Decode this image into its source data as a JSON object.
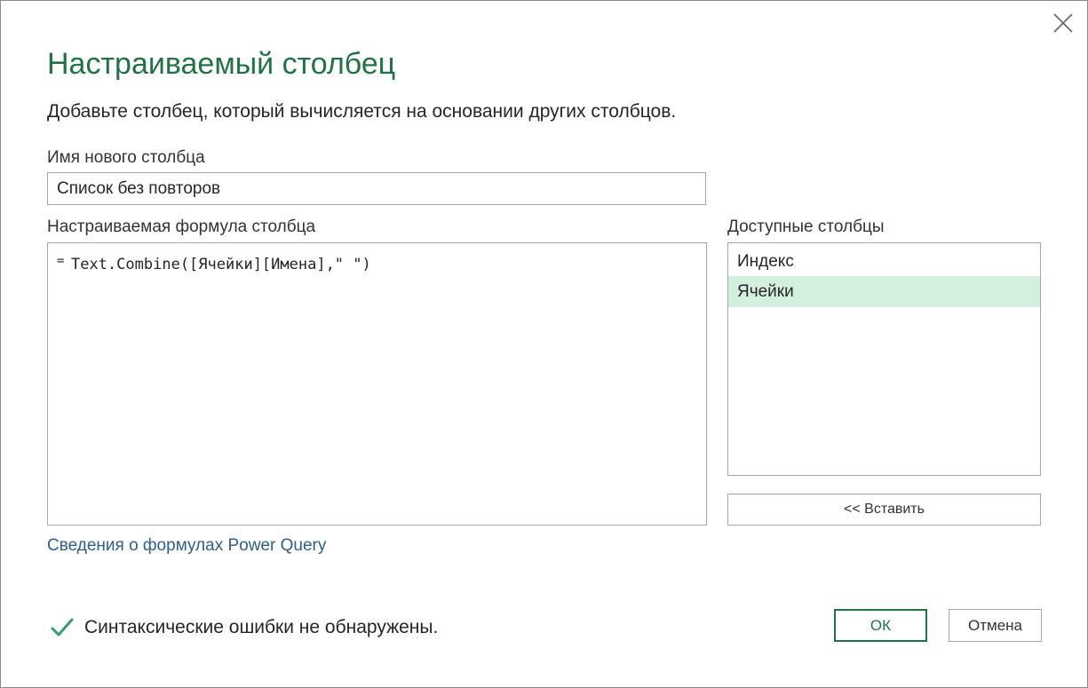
{
  "dialog": {
    "title": "Настраиваемый столбец",
    "subtitle": "Добавьте столбец, который вычисляется на основании других столбцов.",
    "close_icon": "close-icon"
  },
  "new_column_name": {
    "label": "Имя нового столбца",
    "value": "Список без повторов"
  },
  "formula": {
    "label": "Настраиваемая формула столбца",
    "equals": "=",
    "value": "Text.Combine([Ячейки][Имена],\" \")"
  },
  "available_columns": {
    "label": "Доступные столбцы",
    "items": [
      {
        "label": "Индекс",
        "selected": false
      },
      {
        "label": "Ячейки",
        "selected": true
      }
    ],
    "insert_label": "<< Вставить"
  },
  "link": {
    "label": "Сведения о формулах Power Query"
  },
  "status": {
    "icon": "checkmark-icon",
    "text": "Синтаксические ошибки не обнаружены."
  },
  "buttons": {
    "ok_label": "ОК",
    "cancel_label": "Отмена"
  },
  "colors": {
    "accent": "#217346",
    "selection": "#d3f0df",
    "link": "#2e5f8a",
    "border": "#a6a6a6"
  }
}
